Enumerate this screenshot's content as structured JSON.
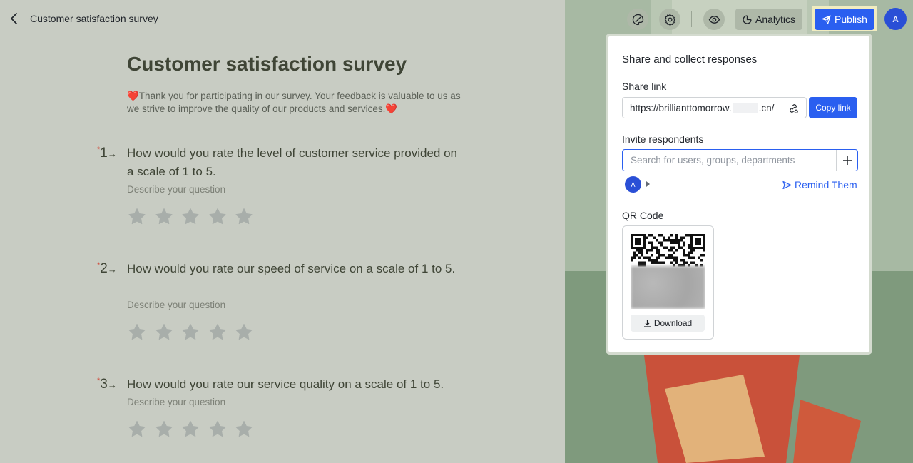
{
  "header": {
    "title": "Customer satisfaction survey",
    "toolbar": {
      "analytics_label": "Analytics",
      "publish_label": "Publish",
      "avatar_initial": "A"
    }
  },
  "form": {
    "title": "Customer satisfaction survey",
    "description": "❤️Thank you for participating in our survey. Your feedback is valuable to us as we strive to improve the quality of our products and services.❤️",
    "questions": [
      {
        "number": "1",
        "required_mark": "*",
        "text": "How would you rate the level of customer service provided on a scale of 1 to 5.",
        "description": "Describe your question",
        "rating_max": 5
      },
      {
        "number": "2",
        "required_mark": "*",
        "text": "How would you rate our speed of service on a scale of 1 to 5.",
        "description": "Describe your question",
        "rating_max": 5
      },
      {
        "number": "3",
        "required_mark": "*",
        "text": "How would you rate our service quality on a scale of 1 to 5.",
        "description": "Describe your question",
        "rating_max": 5
      }
    ]
  },
  "share_panel": {
    "title": "Share and collect responses",
    "share_link_label": "Share link",
    "link_prefix": "https://brillianttomorrow.",
    "link_suffix": ".cn/",
    "copy_label": "Copy link",
    "invite_label": "Invite respondents",
    "search_placeholder": "Search for users, groups, departments",
    "respondent_avatar": "A",
    "remind_label": "Remind Them",
    "qr_label": "QR Code",
    "download_label": "Download"
  },
  "colors": {
    "accent": "#2a5ff0",
    "required": "#d1493a"
  }
}
